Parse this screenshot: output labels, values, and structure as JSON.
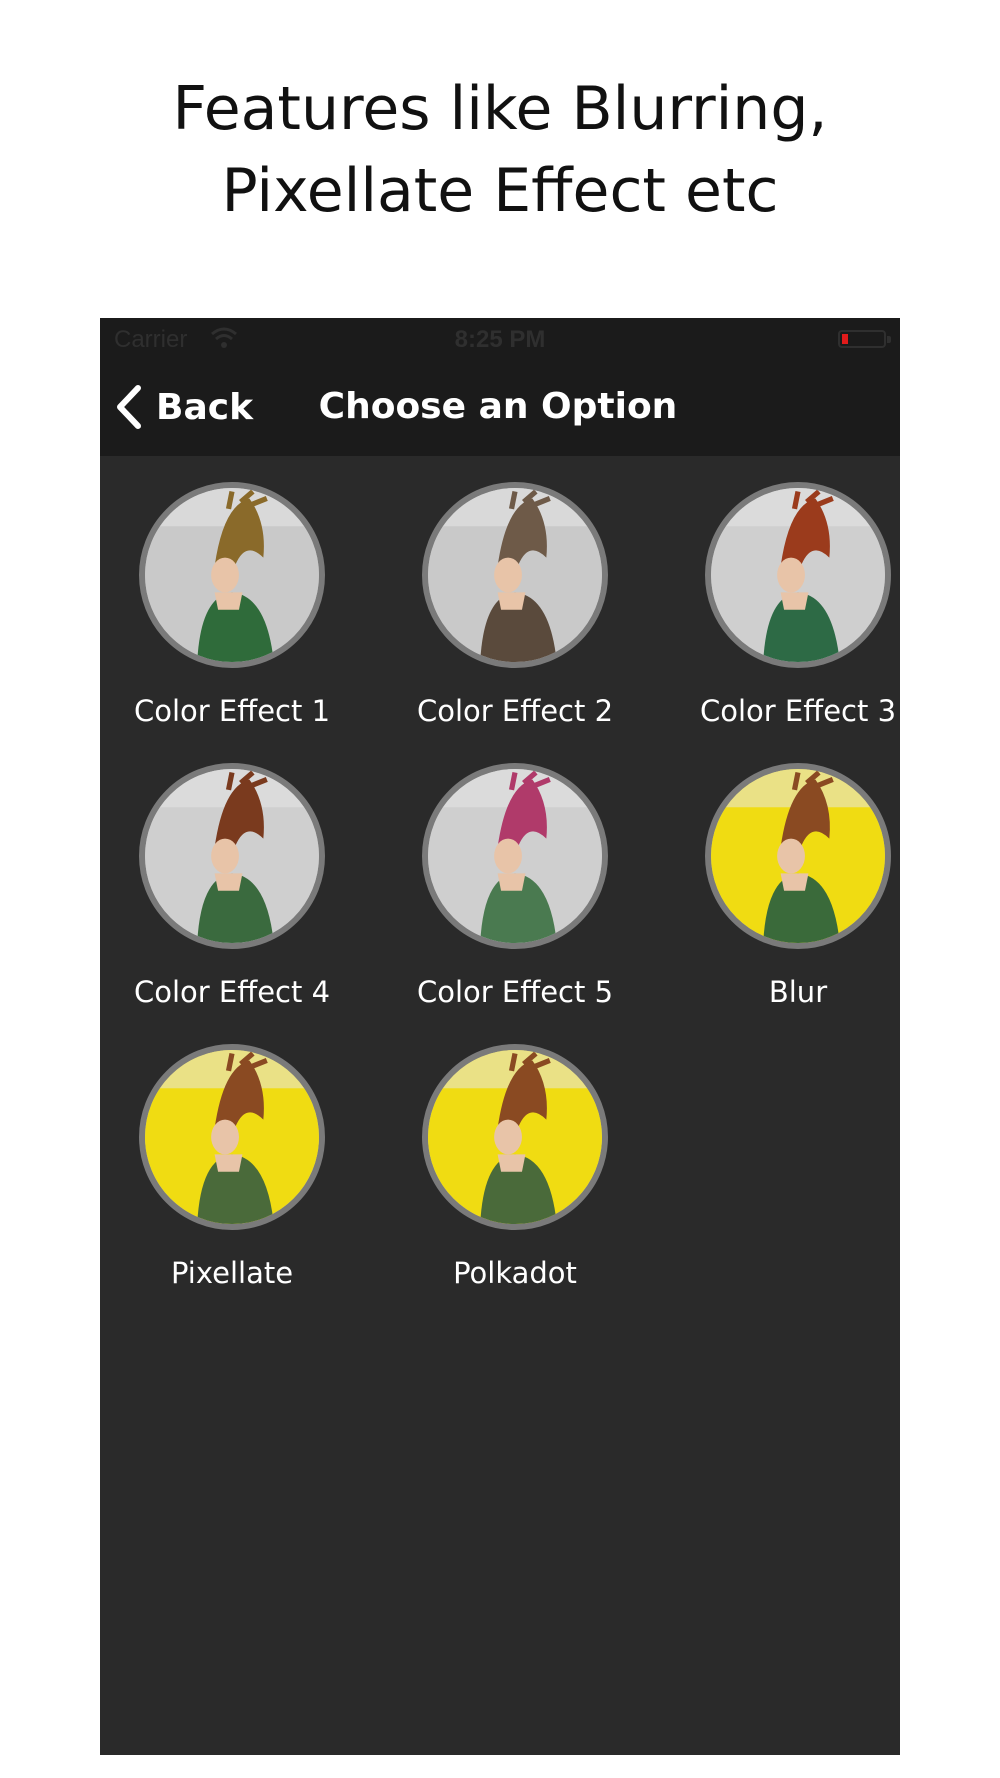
{
  "headline": {
    "line1": "Features like Blurring,",
    "line2": "Pixellate Effect etc"
  },
  "statusbar": {
    "carrier": "Carrier",
    "time": "8:25 PM",
    "battery_level": 0.15,
    "battery_color": "#e21b1b"
  },
  "navbar": {
    "back_label": "Back",
    "title": "Choose an Option"
  },
  "options": [
    {
      "label": "Color Effect 1",
      "bg": "#c9c9c9",
      "hair": "#8a6a2a",
      "dress": "#2f6b3a"
    },
    {
      "label": "Color Effect 2",
      "bg": "#c9c9c9",
      "hair": "#6e5a48",
      "dress": "#5a4a3c"
    },
    {
      "label": "Color Effect 3",
      "bg": "#cfcfcf",
      "hair": "#9b3b1c",
      "dress": "#2d6a45"
    },
    {
      "label": "Color Effect 4",
      "bg": "#cfcfcf",
      "hair": "#7a3a1e",
      "dress": "#3a6a3e"
    },
    {
      "label": "Color Effect 5",
      "bg": "#cfcfcf",
      "hair": "#b03a6a",
      "dress": "#4a7a50"
    },
    {
      "label": "Blur",
      "bg": "#f0dc12",
      "hair": "#8a4a22",
      "dress": "#3a6a3a"
    },
    {
      "label": "Pixellate",
      "bg": "#f0dc12",
      "hair": "#8a4a22",
      "dress": "#4a6a3a"
    },
    {
      "label": "Polkadot",
      "bg": "#f0dc12",
      "hair": "#8a4a22",
      "dress": "#4a6a3a"
    }
  ]
}
